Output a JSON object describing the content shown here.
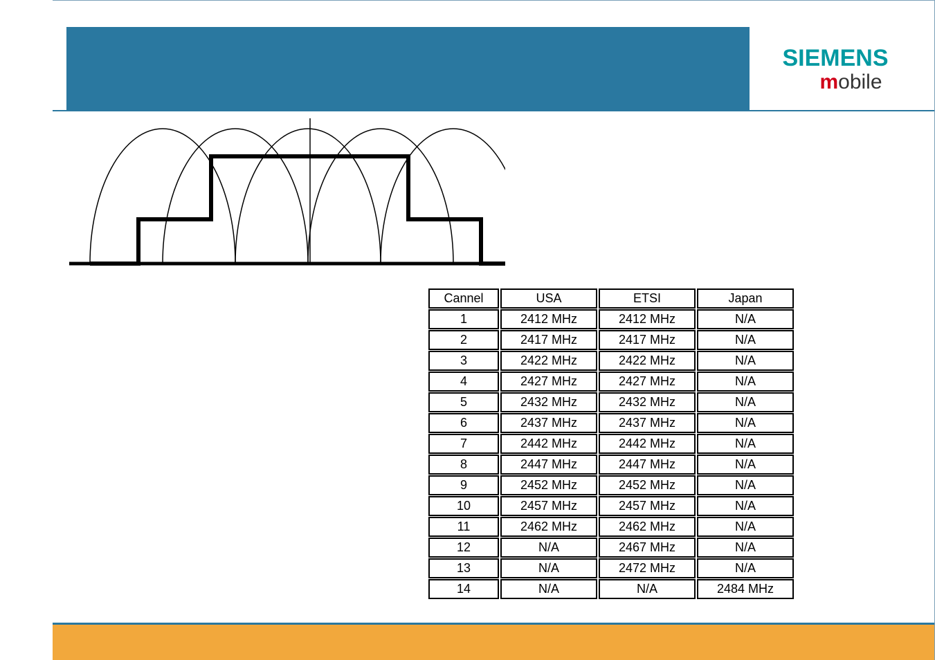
{
  "branding": {
    "siemens": "SIEMENS",
    "mobile_m": "m",
    "mobile_rest": "obile"
  },
  "table": {
    "headers": {
      "channel": "Cannel",
      "usa": "USA",
      "etsi": "ETSI",
      "japan": "Japan"
    },
    "rows": [
      {
        "ch": "1",
        "usa": "2412 MHz",
        "etsi": "2412 MHz",
        "jp": "N/A"
      },
      {
        "ch": "2",
        "usa": "2417 MHz",
        "etsi": "2417 MHz",
        "jp": "N/A"
      },
      {
        "ch": "3",
        "usa": "2422 MHz",
        "etsi": "2422 MHz",
        "jp": "N/A"
      },
      {
        "ch": "4",
        "usa": "2427 MHz",
        "etsi": "2427 MHz",
        "jp": "N/A"
      },
      {
        "ch": "5",
        "usa": "2432 MHz",
        "etsi": "2432 MHz",
        "jp": "N/A"
      },
      {
        "ch": "6",
        "usa": "2437 MHz",
        "etsi": "2437 MHz",
        "jp": "N/A"
      },
      {
        "ch": "7",
        "usa": "2442 MHz",
        "etsi": "2442 MHz",
        "jp": "N/A"
      },
      {
        "ch": "8",
        "usa": "2447 MHz",
        "etsi": "2447 MHz",
        "jp": "N/A"
      },
      {
        "ch": "9",
        "usa": "2452 MHz",
        "etsi": "2452 MHz",
        "jp": "N/A"
      },
      {
        "ch": "10",
        "usa": "2457 MHz",
        "etsi": "2457 MHz",
        "jp": "N/A"
      },
      {
        "ch": "11",
        "usa": "2462 MHz",
        "etsi": "2462 MHz",
        "jp": "N/A"
      },
      {
        "ch": "12",
        "usa": "N/A",
        "etsi": "2467 MHz",
        "jp": "N/A"
      },
      {
        "ch": "13",
        "usa": "N/A",
        "etsi": "2472 MHz",
        "jp": "N/A"
      },
      {
        "ch": "14",
        "usa": "N/A",
        "etsi": "N/A",
        "jp": "2484 MHz"
      }
    ]
  }
}
